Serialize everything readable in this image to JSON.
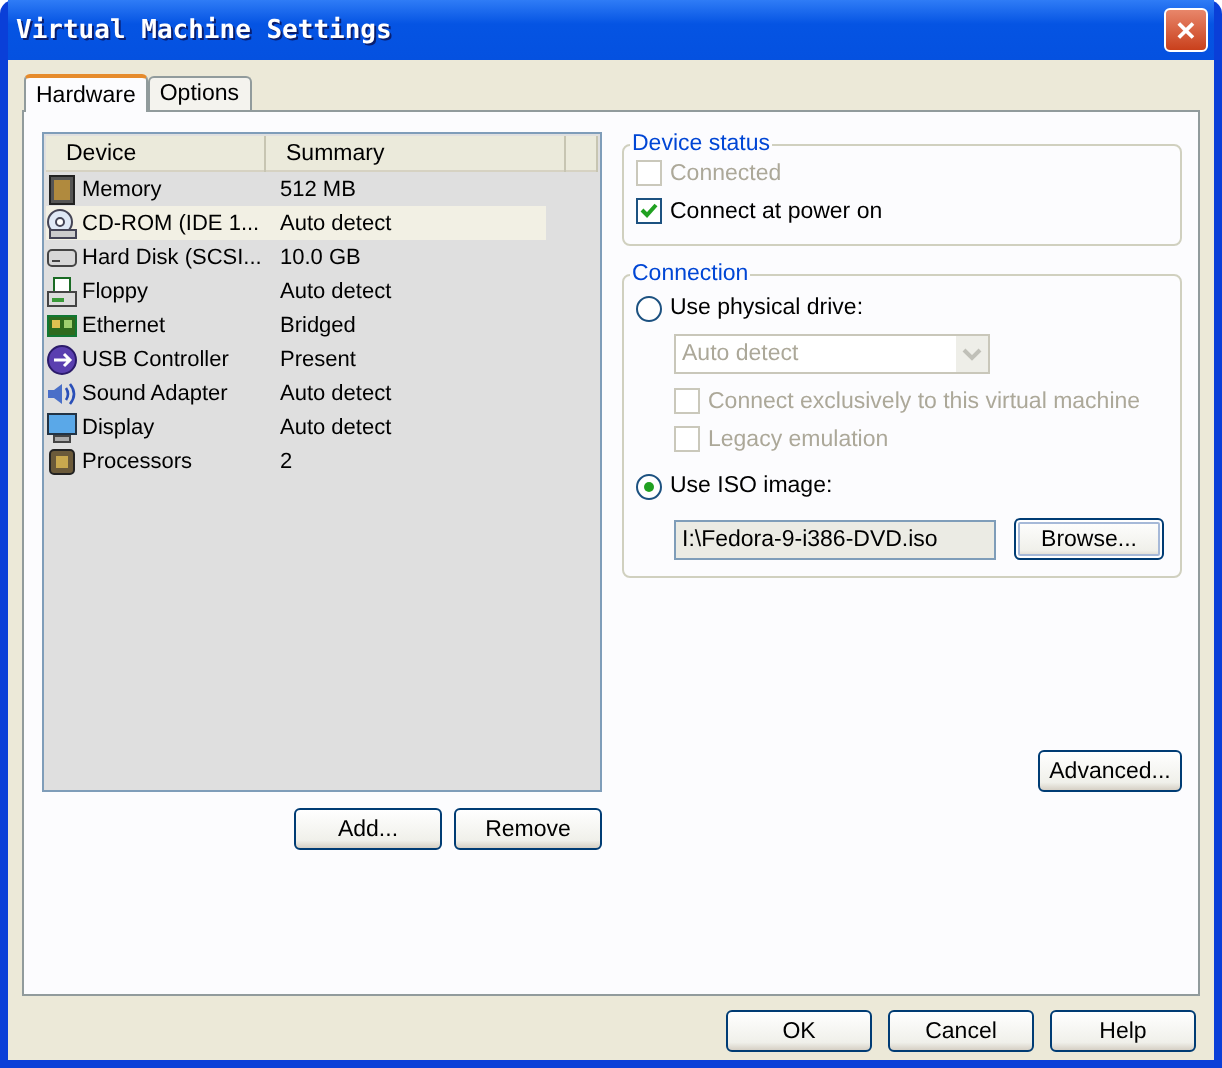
{
  "window": {
    "title": "Virtual Machine Settings",
    "close": "✕"
  },
  "tabs": [
    {
      "label": "Hardware",
      "selected": true
    },
    {
      "label": "Options",
      "selected": false
    }
  ],
  "device_list": {
    "columns": [
      "Device",
      "Summary"
    ],
    "rows": [
      {
        "kind": "memory",
        "device": "Memory",
        "summary": "512 MB",
        "selected": false
      },
      {
        "kind": "cdrom",
        "device": "CD-ROM (IDE 1...",
        "summary": "Auto detect",
        "selected": true
      },
      {
        "kind": "disk",
        "device": "Hard Disk (SCSI...",
        "summary": "10.0 GB",
        "selected": false
      },
      {
        "kind": "floppy",
        "device": "Floppy",
        "summary": "Auto detect",
        "selected": false
      },
      {
        "kind": "network",
        "device": "Ethernet",
        "summary": "Bridged",
        "selected": false
      },
      {
        "kind": "usb",
        "device": "USB Controller",
        "summary": "Present",
        "selected": false
      },
      {
        "kind": "sound",
        "device": "Sound Adapter",
        "summary": "Auto detect",
        "selected": false
      },
      {
        "kind": "display",
        "device": "Display",
        "summary": "Auto detect",
        "selected": false
      },
      {
        "kind": "cpu",
        "device": "Processors",
        "summary": "2",
        "selected": false
      }
    ]
  },
  "list_buttons": [
    "Add...",
    "Remove"
  ],
  "device_status": {
    "title": "Device status",
    "options": [
      {
        "label": "Connected",
        "checked": false,
        "disabled": true
      },
      {
        "label": "Connect at power on",
        "checked": true,
        "disabled": false
      }
    ]
  },
  "connection": {
    "title": "Connection",
    "physical": {
      "label": "Use physical drive:",
      "selected": false,
      "dropdown": {
        "value": "Auto detect",
        "disabled": true
      },
      "options": [
        {
          "label": "Connect exclusively to this virtual machine",
          "checked": false,
          "disabled": true
        },
        {
          "label": "Legacy emulation",
          "checked": false,
          "disabled": true
        }
      ]
    },
    "iso": {
      "label": "Use ISO image:",
      "selected": true,
      "value": "I:\\Fedora-9-i386-DVD.iso",
      "browse": "Browse..."
    }
  },
  "advanced": "Advanced...",
  "footer_buttons": [
    "OK",
    "Cancel",
    "Help"
  ]
}
